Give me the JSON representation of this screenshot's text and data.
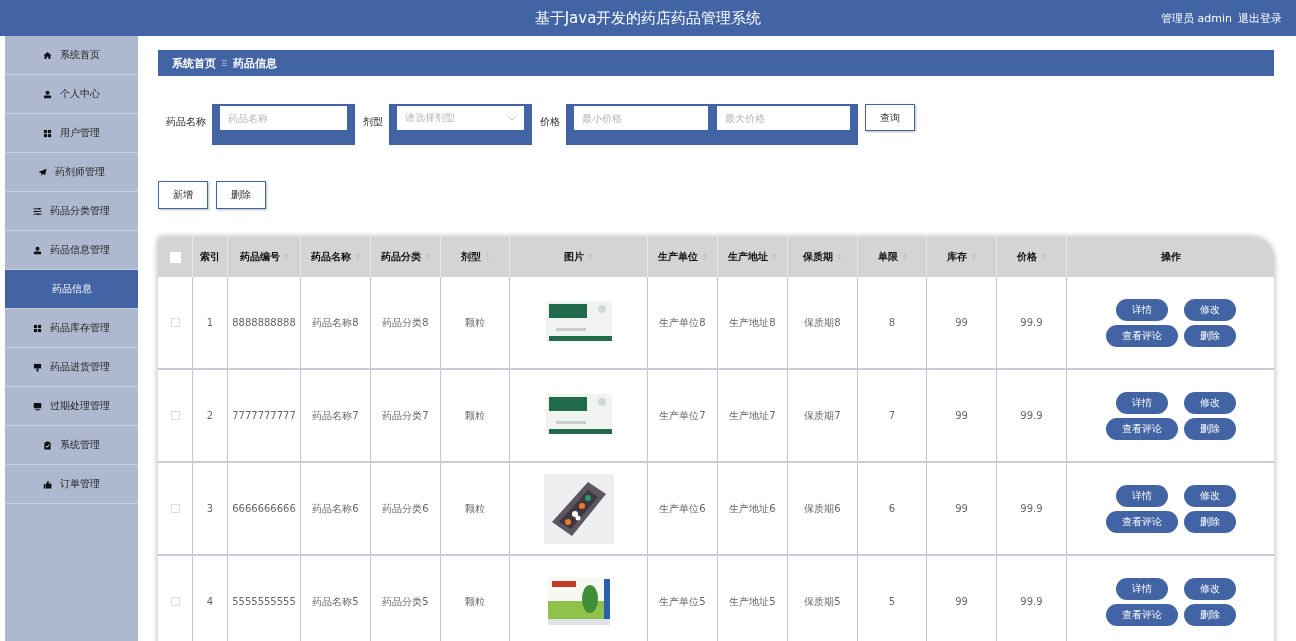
{
  "header": {
    "title": "基于Java开发的药店药品管理系统",
    "user": "管理员 admin",
    "logout": "退出登录"
  },
  "sidebar": {
    "items": [
      {
        "label": "系统首页",
        "selected": false
      },
      {
        "label": "个人中心",
        "selected": false
      },
      {
        "label": "用户管理",
        "selected": false
      },
      {
        "label": "药剂师管理",
        "selected": false
      },
      {
        "label": "药品分类管理",
        "selected": false
      },
      {
        "label": "药品信息管理",
        "selected": false,
        "expanded": true,
        "children": [
          {
            "label": "药品信息",
            "selected": true
          }
        ]
      },
      {
        "label": "药品库存管理",
        "selected": false
      },
      {
        "label": "药品进货管理",
        "selected": false
      },
      {
        "label": "过期处理管理",
        "selected": false
      },
      {
        "label": "系统管理",
        "selected": false
      },
      {
        "label": "订单管理",
        "selected": false
      }
    ]
  },
  "breadcrumb": [
    "系统首页",
    "药品信息"
  ],
  "search": {
    "fields": [
      {
        "label": "药品名称",
        "kind": "text",
        "placeholders": [
          "药品名称"
        ]
      },
      {
        "label": "剂型",
        "kind": "select",
        "placeholders": [
          "请选择剂型"
        ]
      },
      {
        "label": "价格",
        "kind": "range",
        "placeholders": [
          "最小价格",
          "最大价格"
        ]
      }
    ],
    "button": "查询"
  },
  "actions": [
    "新增",
    "删除"
  ],
  "table": {
    "all_checked": false,
    "columns": [
      {
        "label": "索引",
        "sortable": false
      },
      {
        "label": "药品编号",
        "sortable": true
      },
      {
        "label": "药品名称",
        "sortable": true
      },
      {
        "label": "药品分类",
        "sortable": true
      },
      {
        "label": "剂型",
        "sortable": true
      },
      {
        "label": "图片",
        "sortable": true
      },
      {
        "label": "生产单位",
        "sortable": true
      },
      {
        "label": "生产地址",
        "sortable": true
      },
      {
        "label": "保质期",
        "sortable": true
      },
      {
        "label": "单限",
        "sortable": true
      },
      {
        "label": "库存",
        "sortable": true
      },
      {
        "label": "价格",
        "sortable": true
      },
      {
        "label": "操作",
        "sortable": false
      }
    ],
    "rows": [
      {
        "checked": false,
        "cells": [
          "1",
          "8888888888",
          "药品名称8",
          "药品分类8",
          "颗粒",
          null,
          "生产单位8",
          "生产地址8",
          "保质期8",
          "8",
          "99",
          "99.9"
        ],
        "image": {
          "kind": "picture"
        },
        "actions": [
          "详情",
          "修改",
          "查看评论",
          "删除"
        ]
      },
      {
        "checked": false,
        "cells": [
          "2",
          "7777777777",
          "药品名称7",
          "药品分类7",
          "颗粒",
          null,
          "生产单位7",
          "生产地址7",
          "保质期7",
          "7",
          "99",
          "99.9"
        ],
        "image": {
          "kind": "picture"
        },
        "actions": [
          "详情",
          "修改",
          "查看评论",
          "删除"
        ]
      },
      {
        "checked": false,
        "cells": [
          "3",
          "6666666666",
          "药品名称6",
          "药品分类6",
          "颗粒",
          null,
          "生产单位6",
          "生产地址6",
          "保质期6",
          "6",
          "99",
          "99.9"
        ],
        "image": {
          "kind": "picture"
        },
        "actions": [
          "详情",
          "修改",
          "查看评论",
          "删除"
        ]
      },
      {
        "checked": false,
        "cells": [
          "4",
          "5555555555",
          "药品名称5",
          "药品分类5",
          "颗粒",
          null,
          "生产单位5",
          "生产地址5",
          "保质期5",
          "5",
          "99",
          "99.9"
        ],
        "image": {
          "kind": "picture"
        },
        "actions": [
          "详情",
          "修改",
          "查看评论",
          "删除"
        ]
      }
    ]
  }
}
